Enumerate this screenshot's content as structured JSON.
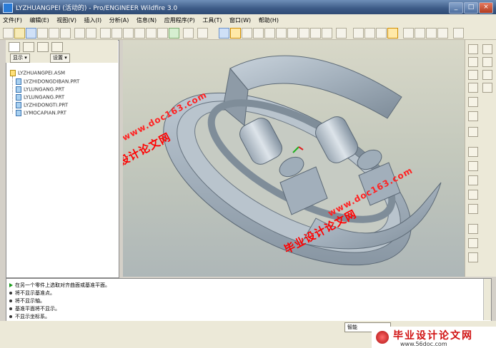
{
  "window": {
    "title": "LYZHUANGPEI (活动的) - Pro/ENGINEER Wildfire 3.0",
    "controls": [
      "_",
      "□",
      "×"
    ]
  },
  "menu": {
    "items": [
      "文件(F)",
      "编辑(E)",
      "视图(V)",
      "插入(I)",
      "分析(A)",
      "信息(N)",
      "应用程序(P)",
      "工具(T)",
      "窗口(W)",
      "帮助(H)"
    ]
  },
  "navigator": {
    "show_label": "显示 ▾",
    "settings_label": "设置 ▾",
    "tree": [
      {
        "name": "LYZHUANGPEI.ASM",
        "type": "asm"
      },
      {
        "name": "LYZHIDONGDIBAN.PRT",
        "type": "prt"
      },
      {
        "name": "LYLUNGANG.PRT",
        "type": "prt"
      },
      {
        "name": "LYLUNGANG.PRT",
        "type": "prt"
      },
      {
        "name": "LYZHIDONGTI.PRT",
        "type": "prt"
      },
      {
        "name": "LYMOCAPIAN.PRT",
        "type": "prt"
      }
    ]
  },
  "watermarks": {
    "brand": "毕业设计论文网",
    "url": "www.doc163.com"
  },
  "messages": [
    {
      "kind": "prompt",
      "text": "在另一个零件上选取对齐曲面或基准平面。"
    },
    {
      "kind": "info",
      "text": "将不显示基准点。"
    },
    {
      "kind": "info",
      "text": "将不显示轴。"
    },
    {
      "kind": "info",
      "text": "基准平面将不显示。"
    },
    {
      "kind": "info",
      "text": "不显示坐标系。"
    }
  ],
  "statusbar": {
    "filter_value": "智能"
  },
  "footer": {
    "brand": "毕业设计论文网",
    "url": "www.56doc.com"
  },
  "colors": {
    "titlebar": "#3c5a86",
    "watermark": "#ff0000",
    "model": "#a9b6c2"
  }
}
